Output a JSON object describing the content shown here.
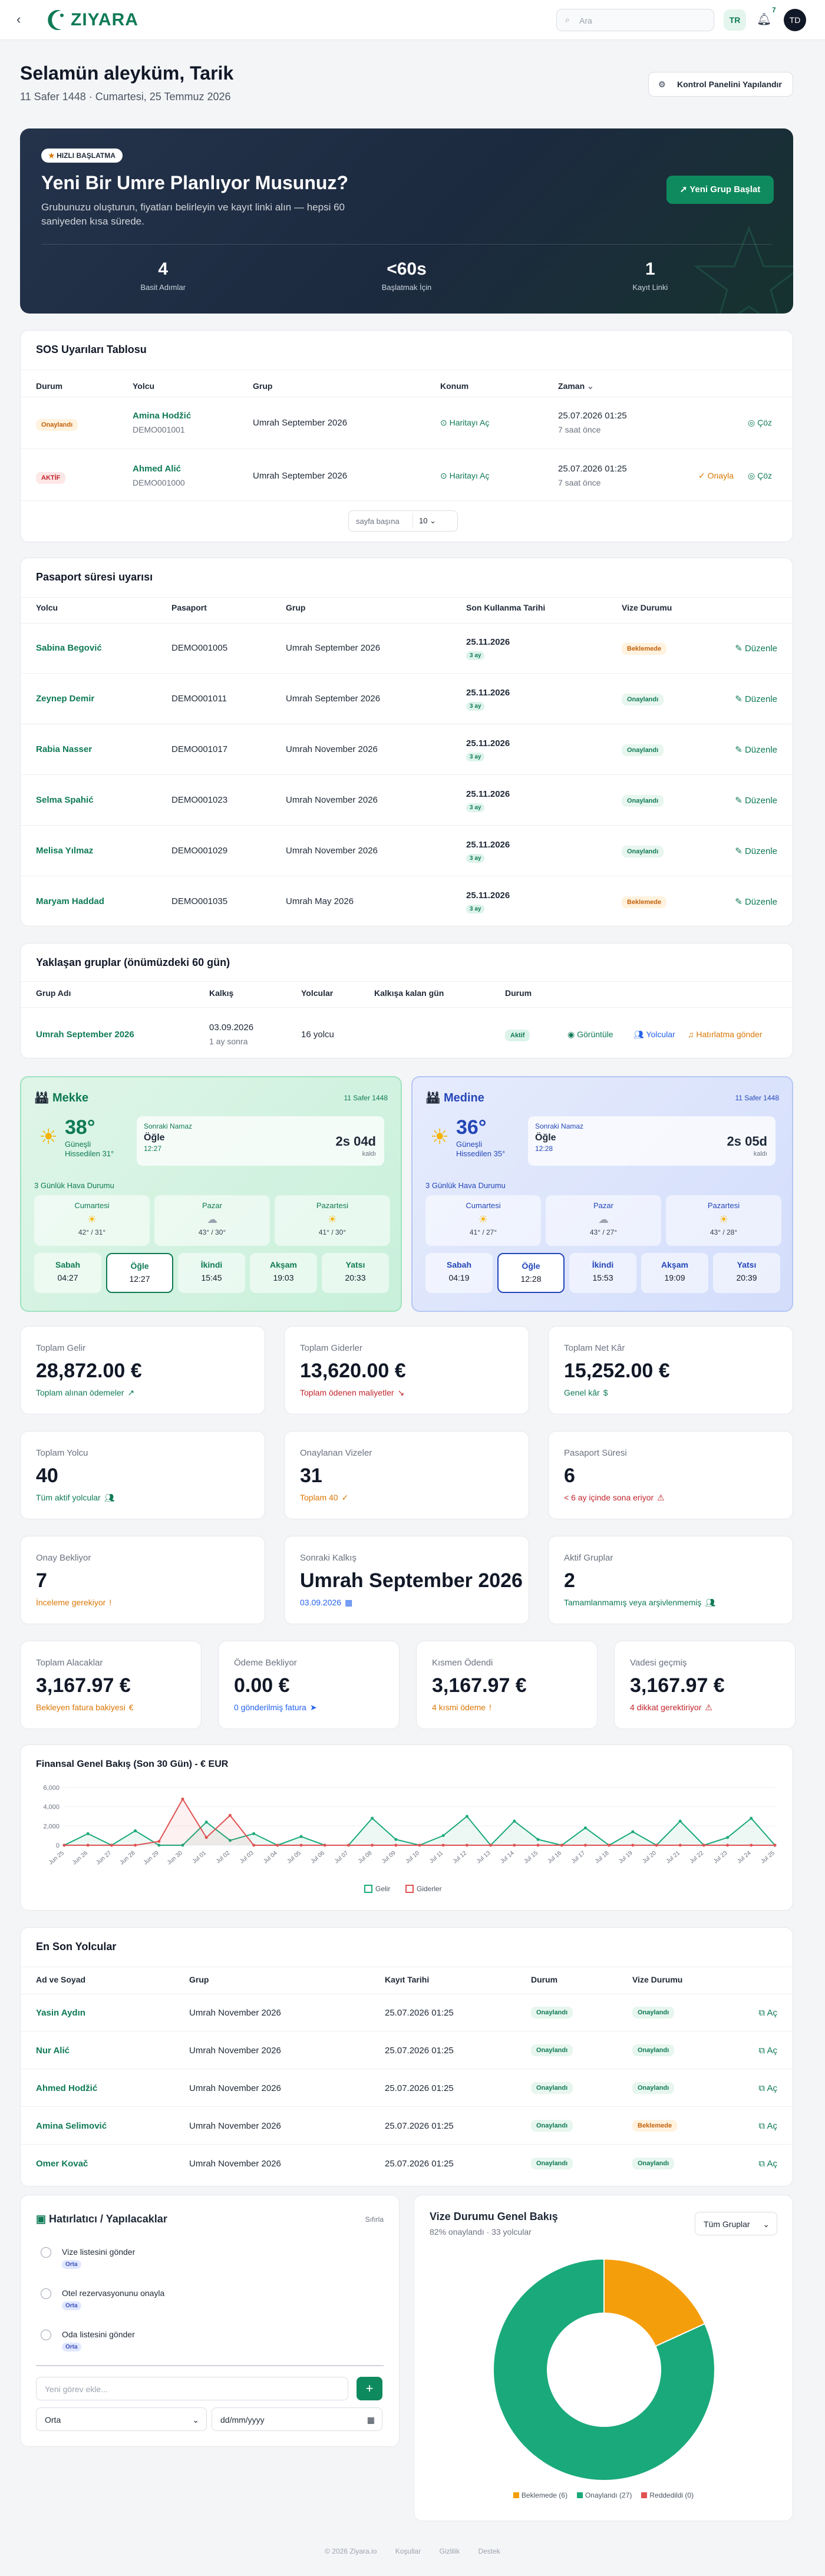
{
  "header": {
    "logo": "ZIYARA",
    "logo_tagline": "",
    "search_placeholder": "Ara",
    "lang": "TR",
    "notif_count": "7",
    "avatar": "TD"
  },
  "welcome": {
    "title": "Selamün aleyküm, Tarik",
    "date": "11 Safer 1448 · Cumartesi, 25 Temmuz 2026",
    "config_button": "Kontrol Panelini Yapılandır"
  },
  "hero": {
    "badge": "HIZLI BAŞLATMA",
    "title": "Yeni Bir Umre Planlıyor Musunuz?",
    "desc": "Grubunuzu oluşturun, fiyatları belirleyin ve kayıt linki alın — hepsi 60 saniyeden kısa sürede.",
    "button": "Yeni Grup Başlat",
    "stats": [
      {
        "value": "4",
        "label": "Basit Adımlar"
      },
      {
        "value": "<60s",
        "label": "Başlatmak İçin"
      },
      {
        "value": "1",
        "label": "Kayıt Linki"
      }
    ]
  },
  "sos": {
    "title": "SOS Uyarıları Tablosu",
    "headers": [
      "Durum",
      "Yolcu",
      "Grup",
      "Konum",
      "Zaman"
    ],
    "rows": [
      {
        "status": "Onaylandı",
        "name": "Amina Hodžić",
        "id": "DEMO001001",
        "group": "Umrah September 2026",
        "map": "Haritayı Aç",
        "time": "25.07.2026 01:25",
        "ago": "7 saat önce",
        "approve": "",
        "resolve": "Çöz"
      },
      {
        "status": "AKTİF",
        "name": "Ahmed Alić",
        "id": "DEMO001000",
        "group": "Umrah September 2026",
        "map": "Haritayı Aç",
        "time": "25.07.2026 01:25",
        "ago": "7 saat önce",
        "approve": "Onayla",
        "resolve": "Çöz"
      }
    ],
    "per_page_label": "sayfa başına",
    "per_page": "10"
  },
  "passport": {
    "title": "Pasaport süresi uyarısı",
    "headers": [
      "Yolcu",
      "Pasaport",
      "Grup",
      "Son Kullanma Tarihi",
      "Vize Durumu"
    ],
    "edit": "Düzenle",
    "rows": [
      {
        "name": "Sabina Begović",
        "passport": "DEMO001005",
        "group": "Umrah September 2026",
        "date": "25.11.2026",
        "left": "3 ay",
        "visa": "Beklemede"
      },
      {
        "name": "Zeynep Demir",
        "passport": "DEMO001011",
        "group": "Umrah September 2026",
        "date": "25.11.2026",
        "left": "3 ay",
        "visa": "Onaylandı"
      },
      {
        "name": "Rabia Nasser",
        "passport": "DEMO001017",
        "group": "Umrah November 2026",
        "date": "25.11.2026",
        "left": "3 ay",
        "visa": "Onaylandı"
      },
      {
        "name": "Selma Spahić",
        "passport": "DEMO001023",
        "group": "Umrah November 2026",
        "date": "25.11.2026",
        "left": "3 ay",
        "visa": "Onaylandı"
      },
      {
        "name": "Melisa Yılmaz",
        "passport": "DEMO001029",
        "group": "Umrah November 2026",
        "date": "25.11.2026",
        "left": "3 ay",
        "visa": "Onaylandı"
      },
      {
        "name": "Maryam Haddad",
        "passport": "DEMO001035",
        "group": "Umrah May 2026",
        "date": "25.11.2026",
        "left": "3 ay",
        "visa": "Beklemede"
      }
    ]
  },
  "upcoming": {
    "title": "Yaklaşan gruplar (önümüzdeki 60 gün)",
    "headers": [
      "Grup Adı",
      "Kalkış",
      "Yolcular",
      "Kalkışa kalan gün",
      "Durum"
    ],
    "row": {
      "name": "Umrah September 2026",
      "date": "03.09.2026",
      "rel": "1 ay sonra",
      "pax": "16 yolcu",
      "days": "",
      "status": "Aktif",
      "view": "Görüntüle",
      "pilgrims": "Yolcular",
      "remind": "Hatırlatma gönder"
    }
  },
  "mekke": {
    "city": "Mekke",
    "hijri": "11 Safer 1448",
    "temp": "38°",
    "cond": "Güneşli",
    "feels": "Hissedilen 31°",
    "next_label": "Sonraki Namaz",
    "next_name": "Öğle",
    "next_time": "12:27",
    "countdown": "2s 04d",
    "cd_left": "kaldı",
    "forecast_title": "3 Günlük Hava Durumu",
    "forecast": [
      {
        "day": "Cumartesi",
        "range": "42° / 31°"
      },
      {
        "day": "Pazar",
        "range": "43° / 30°"
      },
      {
        "day": "Pazartesi",
        "range": "41° / 30°"
      }
    ],
    "prayers": [
      {
        "n": "Sabah",
        "t": "04:27"
      },
      {
        "n": "Öğle",
        "t": "12:27"
      },
      {
        "n": "İkindi",
        "t": "15:45"
      },
      {
        "n": "Akşam",
        "t": "19:03"
      },
      {
        "n": "Yatsı",
        "t": "20:33"
      }
    ]
  },
  "medine": {
    "city": "Medine",
    "hijri": "11 Safer 1448",
    "temp": "36°",
    "cond": "Güneşli",
    "feels": "Hissedilen 35°",
    "next_label": "Sonraki Namaz",
    "next_name": "Öğle",
    "next_time": "12:28",
    "countdown": "2s 05d",
    "cd_left": "kaldı",
    "forecast_title": "3 Günlük Hava Durumu",
    "forecast": [
      {
        "day": "Cumartesi",
        "range": "41° / 27°"
      },
      {
        "day": "Pazar",
        "range": "43° / 27°"
      },
      {
        "day": "Pazartesi",
        "range": "43° / 28°"
      }
    ],
    "prayers": [
      {
        "n": "Sabah",
        "t": "04:19"
      },
      {
        "n": "Öğle",
        "t": "12:28"
      },
      {
        "n": "İkindi",
        "t": "15:53"
      },
      {
        "n": "Akşam",
        "t": "19:09"
      },
      {
        "n": "Yatsı",
        "t": "20:39"
      }
    ]
  },
  "stats": [
    {
      "label": "Toplam Gelir",
      "value": "28,872.00 €",
      "sub": "Toplam alınan ödemeler",
      "color": "#0f7a55"
    },
    {
      "label": "Toplam Giderler",
      "value": "13,620.00 €",
      "sub": "Toplam ödenen maliyetler",
      "color": "#c0262d"
    },
    {
      "label": "Toplam Net Kâr",
      "value": "15,252.00 €",
      "sub": "Genel kâr",
      "color": "#0f7a55"
    },
    {
      "label": "Toplam Yolcu",
      "value": "40",
      "sub": "Tüm aktif yolcular",
      "color": "#0f7a55"
    },
    {
      "label": "Onaylanan Vizeler",
      "value": "31",
      "sub": "Toplam 40",
      "color": "#d97706"
    },
    {
      "label": "Pasaport Süresi",
      "value": "6",
      "sub": "< 6 ay içinde sona eriyor",
      "color": "#c0262d"
    },
    {
      "label": "Onay Bekliyor",
      "value": "7",
      "sub": "İnceleme gerekiyor",
      "color": "#d97706"
    },
    {
      "label": "Sonraki Kalkış",
      "value": "Umrah September 2026",
      "sub": "03.09.2026",
      "color": "#2563eb"
    },
    {
      "label": "Aktif Gruplar",
      "value": "2",
      "sub": "Tamamlanmamış veya arşivlenmemiş",
      "color": "#0f7a55"
    }
  ],
  "stats4": [
    {
      "label": "Toplam Alacaklar",
      "value": "3,167.97 €",
      "sub": "Bekleyen fatura bakiyesi",
      "color": "#d97706"
    },
    {
      "label": "Ödeme Bekliyor",
      "value": "0.00 €",
      "sub": "0 gönderilmiş fatura",
      "color": "#2563eb"
    },
    {
      "label": "Kısmen Ödendi",
      "value": "3,167.97 €",
      "sub": "4 kısmi ödeme",
      "color": "#d97706"
    },
    {
      "label": "Vadesi geçmiş",
      "value": "3,167.97 €",
      "sub": "4 dikkat gerektiriyor",
      "color": "#c0262d"
    }
  ],
  "chart_data": {
    "type": "line",
    "title": "Finansal Genel Bakış (Son 30 Gün) - € EUR",
    "x": [
      "Jun 25",
      "Jun 26",
      "Jun 27",
      "Jun 28",
      "Jun 29",
      "Jun 30",
      "Jul 01",
      "Jul 02",
      "Jul 03",
      "Jul 04",
      "Jul 05",
      "Jul 06",
      "Jul 07",
      "Jul 08",
      "Jul 09",
      "Jul 10",
      "Jul 11",
      "Jul 12",
      "Jul 13",
      "Jul 14",
      "Jul 15",
      "Jul 16",
      "Jul 17",
      "Jul 18",
      "Jul 19",
      "Jul 20",
      "Jul 21",
      "Jul 22",
      "Jul 23",
      "Jul 24",
      "Jul 25"
    ],
    "series": [
      {
        "name": "Gelir",
        "color": "#1aa97a",
        "values": [
          0,
          1200,
          0,
          1500,
          0,
          0,
          2400,
          500,
          1200,
          0,
          900,
          0,
          0,
          2800,
          600,
          0,
          1000,
          3000,
          0,
          2500,
          600,
          0,
          1800,
          0,
          1400,
          0,
          2500,
          0,
          800,
          2800,
          0
        ]
      },
      {
        "name": "Giderler",
        "color": "#e05252",
        "values": [
          0,
          0,
          0,
          0,
          400,
          4800,
          800,
          3100,
          0,
          0,
          0,
          0,
          0,
          0,
          0,
          0,
          0,
          0,
          0,
          0,
          0,
          0,
          0,
          0,
          0,
          0,
          0,
          0,
          0,
          0,
          0
        ]
      }
    ],
    "yticks": [
      0,
      2000,
      4000,
      6000
    ],
    "ylim": [
      0,
      6000
    ]
  },
  "recent": {
    "title": "En Son Yolcular",
    "headers": [
      "Ad ve Soyad",
      "Grup",
      "Kayıt Tarihi",
      "Durum",
      "Vize Durumu"
    ],
    "open": "Aç",
    "rows": [
      {
        "name": "Yasin Aydın",
        "group": "Umrah November 2026",
        "date": "25.07.2026 01:25",
        "status": "Onaylandı",
        "visa": "Onaylandı"
      },
      {
        "name": "Nur Alić",
        "group": "Umrah November 2026",
        "date": "25.07.2026 01:25",
        "status": "Onaylandı",
        "visa": "Onaylandı"
      },
      {
        "name": "Ahmed Hodžić",
        "group": "Umrah November 2026",
        "date": "25.07.2026 01:25",
        "status": "Onaylandı",
        "visa": "Onaylandı"
      },
      {
        "name": "Amina Selimović",
        "group": "Umrah November 2026",
        "date": "25.07.2026 01:25",
        "status": "Onaylandı",
        "visa": "Beklemede"
      },
      {
        "name": "Omer Kovač",
        "group": "Umrah November 2026",
        "date": "25.07.2026 01:25",
        "status": "Onaylandı",
        "visa": "Onaylandı"
      }
    ]
  },
  "todo": {
    "title": "Hatırlatıcı / Yapılacaklar",
    "reset": "Sıfırla",
    "items": [
      {
        "text": "Vize listesini gönder",
        "prio": "Orta"
      },
      {
        "text": "Otel rezervasyonunu onayla",
        "prio": "Orta"
      },
      {
        "text": "Oda listesini gönder",
        "prio": "Orta"
      }
    ],
    "add_placeholder": "Yeni görev ekle...",
    "prio_select": "Orta",
    "date_placeholder": "dd/mm/yyyy"
  },
  "visa": {
    "title": "Vize Durumu Genel Bakış",
    "sub": "82% onaylandı · 33 yolcular",
    "filter": "Tüm Gruplar",
    "legend": [
      {
        "label": "Beklemede (6)",
        "color": "#f59e0b",
        "value": 6
      },
      {
        "label": "Onaylandı (27)",
        "color": "#1aa97a",
        "value": 27
      },
      {
        "label": "Reddedildi (0)",
        "color": "#e05252",
        "value": 0
      }
    ]
  },
  "footer": [
    "© 2026 Ziyara.io",
    "Koşullar",
    "Gizlilik",
    "Destek"
  ]
}
